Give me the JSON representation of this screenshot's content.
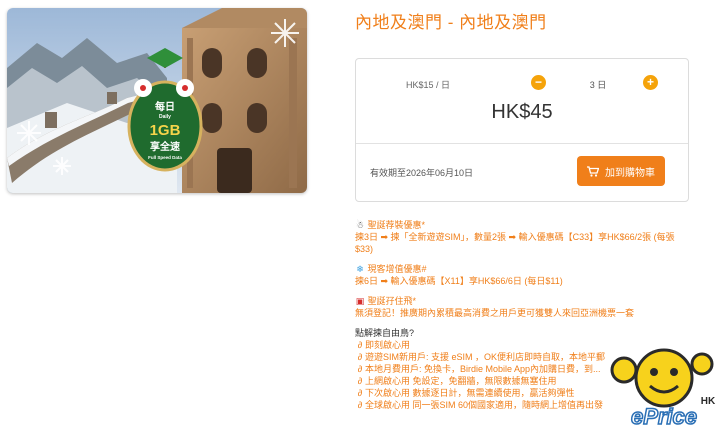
{
  "product": {
    "image_badge": {
      "top": "每日",
      "sub": "Daily",
      "amount": "1GB",
      "speed_cn": "享全速",
      "speed_en": "Full Speed Data"
    }
  },
  "title": "內地及澳門 - 內地及澳門",
  "purchase": {
    "rate": "HK$15 / 日",
    "minus_icon": "minus-icon",
    "plus_icon": "plus-icon",
    "days": "3 日",
    "price": "HK$45",
    "validity": "有效期至2026年06月10日",
    "cart_label": "加到購物車",
    "accent": "#f07f1a",
    "stepper_color": "#f5a30a"
  },
  "promos": {
    "xmas_head": "聖誕荐裝優惠*",
    "xmas_line1": "揀3日 ➡ 揀「全新遊遊SIM」，數量2張 ➡ 輸入優惠碼【C33】享HK$66/2張 (每張",
    "xmas_line2": "$33)",
    "topup_head": "現客增值優惠#",
    "topup_line": "揀6日 ➡ 輸入優惠碼【X11】享HK$66/6日 (每日$11)",
    "gift_head": "聖誕孖住飛*",
    "gift_line": "無須登記！推廣期內累積最高消費之用戶更可獲雙人來回亞洲機票一套",
    "why_head": "點解揀自由鳥?",
    "features": [
      "即刻啟心用",
      "遊遊SIM新用戶: 支援 eSIM ，OK便利店即時自取，本地平郵",
      "本地月費用戶: 免換卡，Birdie Mobile App內加購日費，到...",
      "上網啟心用 免設定，免翻牆，無限數據無塞住用",
      "下次啟心用 數據逐日計，無需連續使用，贏活夠彈性",
      "全球啟心用 同一張SIM 60個國家適用，隨時網上增值再出發"
    ]
  },
  "watermark": {
    "text": "ePrice",
    "region": "HK"
  }
}
